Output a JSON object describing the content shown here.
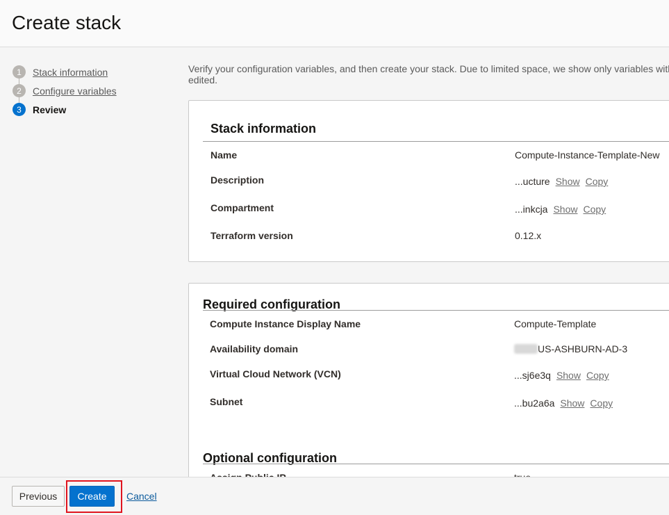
{
  "page": {
    "title": "Create stack"
  },
  "steps": [
    {
      "number": "1",
      "label": "Stack information",
      "state": "complete"
    },
    {
      "number": "2",
      "label": "Configure variables",
      "state": "complete"
    },
    {
      "number": "3",
      "label": "Review",
      "state": "active"
    }
  ],
  "intro_text": "Verify your configuration variables, and then create your stack. Due to limited space, we show only variables with",
  "intro_text_2": "edited.",
  "stack_info": {
    "title": "Stack information",
    "rows": [
      {
        "label": "Name",
        "value": "Compute-Instance-Template-New"
      },
      {
        "label": "Description",
        "value": "...ucture",
        "show": "Show",
        "copy": "Copy"
      },
      {
        "label": "Compartment",
        "value": "...inkcja",
        "show": "Show",
        "copy": "Copy"
      },
      {
        "label": "Terraform version",
        "value": "0.12.x"
      }
    ]
  },
  "required_config": {
    "title": "Required configuration",
    "rows": [
      {
        "label": "Compute Instance Display Name",
        "value": "Compute-Template"
      },
      {
        "label": "Availability domain",
        "value": "US-ASHBURN-AD-3"
      },
      {
        "label": "Virtual Cloud Network (VCN)",
        "value": "...sj6e3q",
        "show": "Show",
        "copy": "Copy"
      },
      {
        "label": "Subnet",
        "value": "...bu2a6a",
        "show": "Show",
        "copy": "Copy"
      }
    ]
  },
  "optional_config": {
    "title": "Optional configuration",
    "rows": [
      {
        "label": "Assign Public IP",
        "value": "true"
      }
    ]
  },
  "footer": {
    "previous_label": "Previous",
    "create_label": "Create",
    "cancel_label": "Cancel"
  },
  "colors": {
    "primary": "#0572ce",
    "highlight": "#e0141f",
    "step_inactive": "#b8b5b1"
  }
}
